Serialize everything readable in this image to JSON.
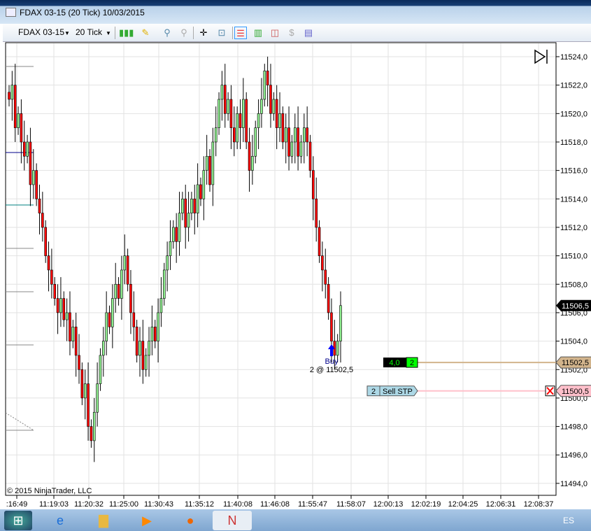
{
  "window": {
    "title": "FDAX 03-15 (20 Tick)  10/03/2015"
  },
  "toolbar": {
    "instrument": "FDAX 03-15",
    "interval": "20 Tick",
    "icons": [
      "candlestick-style-icon",
      "pencil-draw-icon",
      "zoom-in-icon",
      "zoom-out-icon",
      "crosshair-icon",
      "zoom-search-icon",
      "chart-trader-icon",
      "bar-data-icon",
      "indicators-icon",
      "strategies-icon",
      "properties-icon"
    ]
  },
  "chart_data": {
    "type": "candlestick",
    "instrument": "FDAX 03-15",
    "interval": "20 Tick",
    "ylim": [
      11493,
      11525
    ],
    "y_ticks": [
      "11494,0",
      "11496,0",
      "11498,0",
      "11500,0",
      "11502,0",
      "11504,0",
      "11506,0",
      "11508,0",
      "11510,0",
      "11512,0",
      "11514,0",
      "11516,0",
      "11518,0",
      "11520,0",
      "11522,0",
      "11524,0"
    ],
    "x_ticks": [
      ":16:49",
      "11:19:03",
      "11:20:32",
      "11:25:00",
      "11:30:43",
      "11:35:12",
      "11:40:08",
      "11:46:08",
      "11:55:47",
      "11:58:07",
      "12:00:13",
      "12:02:19",
      "12:04:25",
      "12:06:31",
      "12:08:37"
    ],
    "closes": [
      11521,
      11522,
      11519,
      11520,
      11518,
      11517,
      11518,
      11515,
      11516,
      11514,
      11513,
      11512,
      11510,
      11509,
      11508,
      11507,
      11506,
      11507,
      11505.5,
      11506,
      11504,
      11505,
      11503,
      11502,
      11500,
      11501,
      11498,
      11497,
      11499,
      11501,
      11503,
      11504,
      11506,
      11505,
      11507,
      11508,
      11507,
      11509,
      11510,
      11508,
      11506,
      11505,
      11503,
      11504,
      11502,
      11503,
      11504,
      11505,
      11504,
      11506,
      11507,
      11509,
      11510,
      11511,
      11512,
      11511,
      11513,
      11514,
      11512,
      11513,
      11514,
      11513,
      11515,
      11514,
      11516,
      11517,
      11515,
      11518,
      11519,
      11521,
      11522,
      11520,
      11521,
      11519,
      11518,
      11520,
      11519,
      11521,
      11518,
      11516,
      11517,
      11519,
      11520,
      11521,
      11523,
      11522,
      11520,
      11521,
      11519,
      11520,
      11518,
      11519,
      11517,
      11518,
      11519,
      11517,
      11518,
      11519,
      11518,
      11516,
      11514,
      11512,
      11510,
      11509,
      11508,
      11506,
      11504,
      11503,
      11504,
      11506.5
    ],
    "colors": {
      "up": "#90ee90",
      "down": "#ff0000",
      "wick": "#000000"
    },
    "grid": true,
    "last_price": {
      "value": 11506.5,
      "label": "11506,5"
    },
    "execution": {
      "label": "Buy",
      "detail": "2 @ 11502,5",
      "price": 11502.5
    },
    "position": {
      "pnl": "4,0",
      "qty": "2",
      "price": 11502.5,
      "label": "11502,5",
      "color": "#d2b48c"
    },
    "stop_order": {
      "qty": "2",
      "type": "Sell STP",
      "price": 11500.5,
      "label": "11500,5",
      "color": "#ffc0cb"
    },
    "copyright": "© 2015 NinjaTrader, LLC"
  },
  "taskbar": {
    "language": "ES",
    "apps": [
      "start-button",
      "internet-explorer-icon",
      "file-explorer-icon",
      "media-player-icon",
      "firefox-icon",
      "ninjatrader-icon"
    ]
  }
}
